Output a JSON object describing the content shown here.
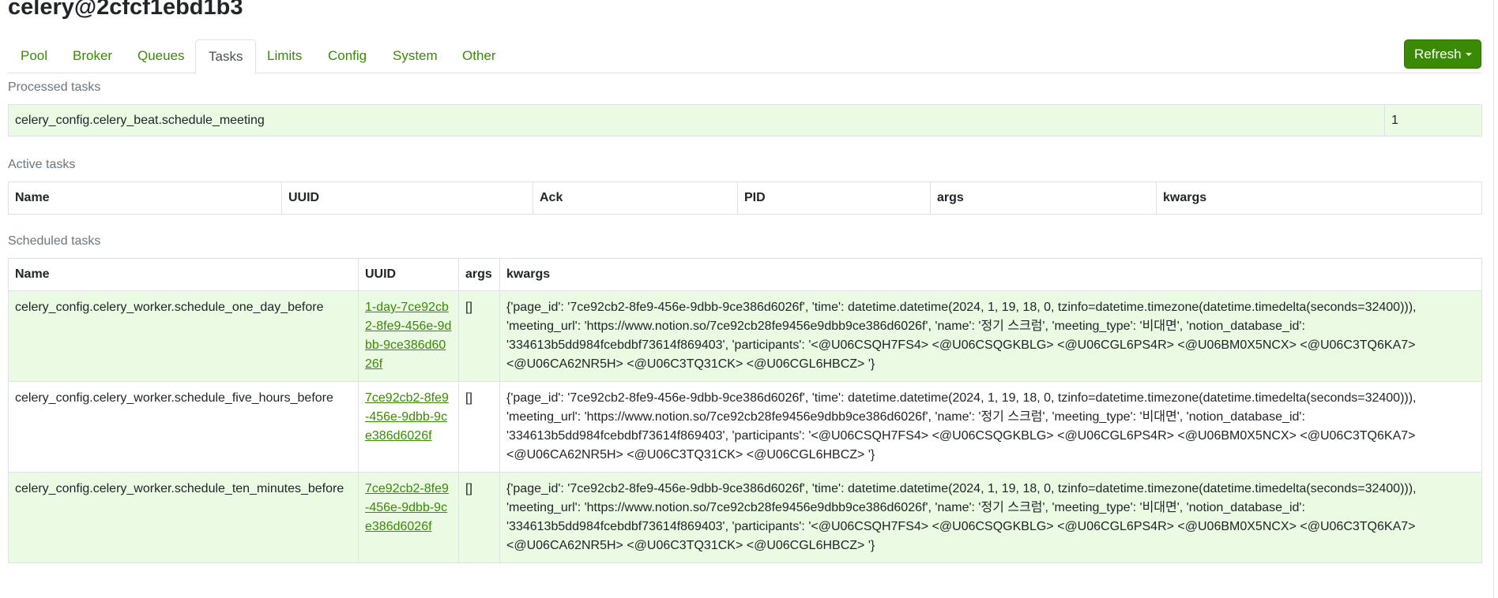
{
  "worker_name": "celery@2cfcf1ebd1b3",
  "tabs": [
    {
      "label": "Pool"
    },
    {
      "label": "Broker"
    },
    {
      "label": "Queues"
    },
    {
      "label": "Tasks",
      "active": true
    },
    {
      "label": "Limits"
    },
    {
      "label": "Config"
    },
    {
      "label": "System"
    },
    {
      "label": "Other"
    }
  ],
  "refresh_label": "Refresh",
  "colors": {
    "accent": "#3a8a05",
    "row_highlight": "#ebfae3"
  },
  "processed": {
    "title": "Processed tasks",
    "rows": [
      {
        "name": "celery_config.celery_beat.schedule_meeting",
        "count": "1"
      }
    ]
  },
  "active": {
    "title": "Active tasks",
    "columns": [
      "Name",
      "UUID",
      "Ack",
      "PID",
      "args",
      "kwargs"
    ]
  },
  "scheduled": {
    "title": "Scheduled tasks",
    "columns": [
      "Name",
      "UUID",
      "args",
      "kwargs"
    ],
    "rows": [
      {
        "name": "celery_config.celery_worker.schedule_one_day_before",
        "uuid": "1-day-7ce92cb2-8fe9-456e-9dbb-9ce386d6026f",
        "args": "[]",
        "kwargs": "{'page_id': '7ce92cb2-8fe9-456e-9dbb-9ce386d6026f', 'time': datetime.datetime(2024, 1, 19, 18, 0, tzinfo=datetime.timezone(datetime.timedelta(seconds=32400))), 'meeting_url': 'https://www.notion.so/7ce92cb28fe9456e9dbb9ce386d6026f', 'name': '정기 스크럼', 'meeting_type': '비대면', 'notion_database_id': '334613b5dd984fcebdbf73614f869403', 'participants': '<@U06CSQH7FS4> <@U06CSQGKBLG> <@U06CGL6PS4R> <@U06BM0X5NCX> <@U06C3TQ6KA7> <@U06CA62NR5H> <@U06C3TQ31CK> <@U06CGL6HBCZ> '}"
      },
      {
        "name": "celery_config.celery_worker.schedule_five_hours_before",
        "uuid": "7ce92cb2-8fe9-456e-9dbb-9ce386d6026f",
        "args": "[]",
        "kwargs": "{'page_id': '7ce92cb2-8fe9-456e-9dbb-9ce386d6026f', 'time': datetime.datetime(2024, 1, 19, 18, 0, tzinfo=datetime.timezone(datetime.timedelta(seconds=32400))), 'meeting_url': 'https://www.notion.so/7ce92cb28fe9456e9dbb9ce386d6026f', 'name': '정기 스크럼', 'meeting_type': '비대면', 'notion_database_id': '334613b5dd984fcebdbf73614f869403', 'participants': '<@U06CSQH7FS4> <@U06CSQGKBLG> <@U06CGL6PS4R> <@U06BM0X5NCX> <@U06C3TQ6KA7> <@U06CA62NR5H> <@U06C3TQ31CK> <@U06CGL6HBCZ> '}"
      },
      {
        "name": "celery_config.celery_worker.schedule_ten_minutes_before",
        "uuid": "7ce92cb2-8fe9-456e-9dbb-9ce386d6026f",
        "args": "[]",
        "kwargs": "{'page_id': '7ce92cb2-8fe9-456e-9dbb-9ce386d6026f', 'time': datetime.datetime(2024, 1, 19, 18, 0, tzinfo=datetime.timezone(datetime.timedelta(seconds=32400))), 'meeting_url': 'https://www.notion.so/7ce92cb28fe9456e9dbb9ce386d6026f', 'name': '정기 스크럼', 'meeting_type': '비대면', 'notion_database_id': '334613b5dd984fcebdbf73614f869403', 'participants': '<@U06CSQH7FS4> <@U06CSQGKBLG> <@U06CGL6PS4R> <@U06BM0X5NCX> <@U06C3TQ6KA7> <@U06CA62NR5H> <@U06C3TQ31CK> <@U06CGL6HBCZ> '}"
      }
    ]
  }
}
